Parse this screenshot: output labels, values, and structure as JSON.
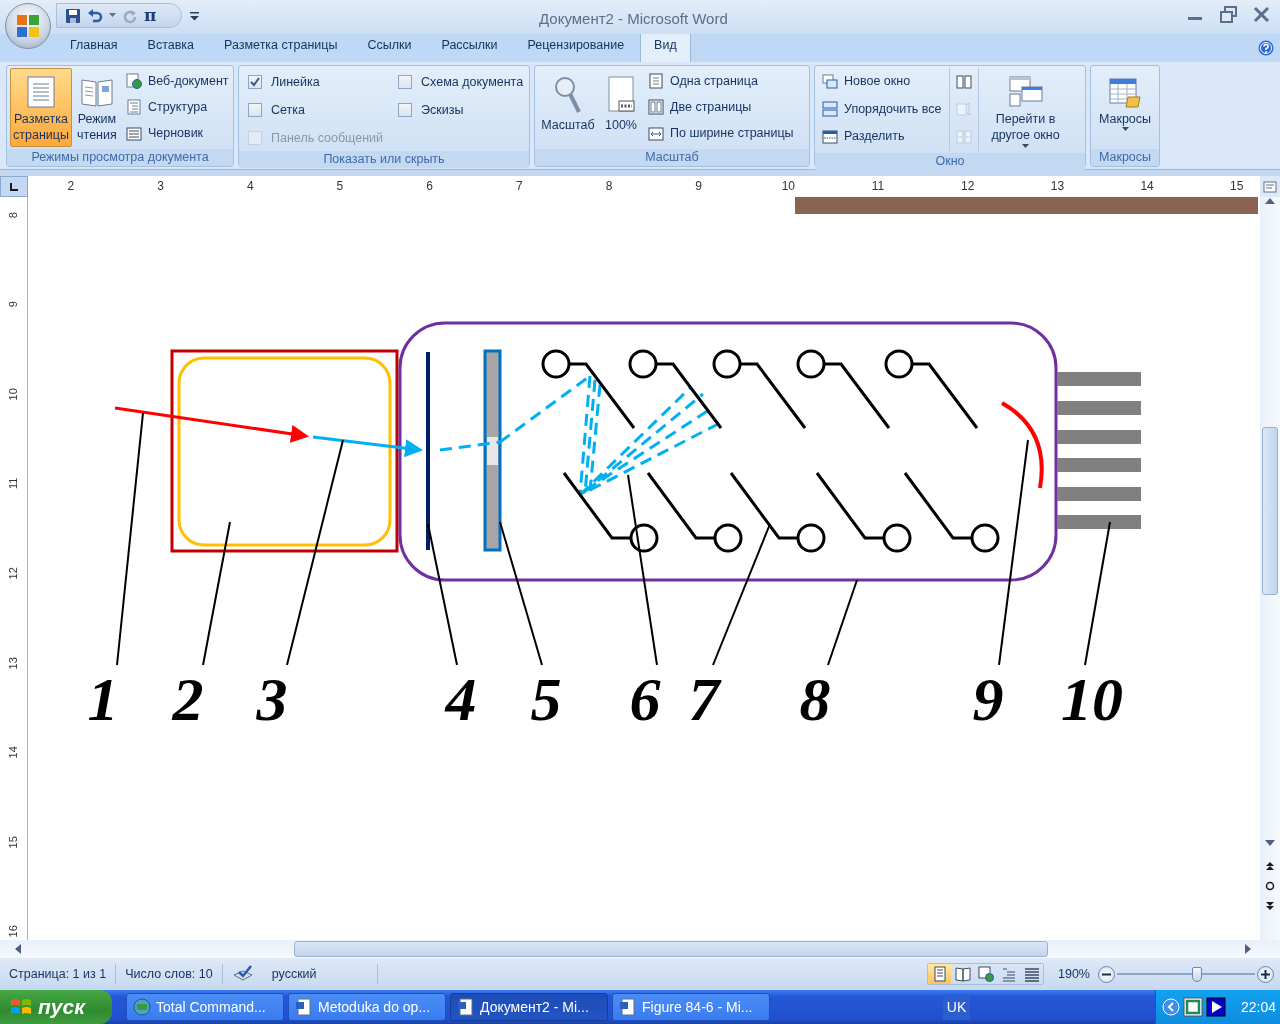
{
  "window": {
    "title": "Документ2 - Microsoft Word"
  },
  "quick_access": {
    "equation_symbol": "π"
  },
  "tabs": [
    {
      "label": "Главная",
      "selected": false
    },
    {
      "label": "Вставка",
      "selected": false
    },
    {
      "label": "Разметка страницы",
      "selected": false
    },
    {
      "label": "Ссылки",
      "selected": false
    },
    {
      "label": "Рассылки",
      "selected": false
    },
    {
      "label": "Рецензирование",
      "selected": false
    },
    {
      "label": "Вид",
      "selected": true
    }
  ],
  "ribbon": {
    "groups": [
      {
        "title": "Режимы просмотра документа",
        "columns": [
          {
            "kind": "large",
            "label": "Разметка страницы",
            "selected": true
          },
          {
            "kind": "large",
            "label": "Режим чтения",
            "selected": false
          },
          {
            "kind": "stack",
            "items": [
              {
                "label": "Веб-документ"
              },
              {
                "label": "Структура"
              },
              {
                "label": "Черновик"
              }
            ]
          }
        ]
      },
      {
        "title": "Показать или скрыть",
        "columns": [
          {
            "kind": "checks",
            "items": [
              {
                "label": "Линейка",
                "checked": true,
                "disabled": false
              },
              {
                "label": "Сетка",
                "checked": false,
                "disabled": false
              },
              {
                "label": "Панель сообщений",
                "checked": false,
                "disabled": true
              }
            ]
          },
          {
            "kind": "checks",
            "items": [
              {
                "label": "Схема документа",
                "checked": false,
                "disabled": false
              },
              {
                "label": "Эскизы",
                "checked": false,
                "disabled": false
              }
            ]
          }
        ]
      },
      {
        "title": "Масштаб",
        "columns": [
          {
            "kind": "large",
            "label": "Масштаб"
          },
          {
            "kind": "large",
            "label": "100%"
          },
          {
            "kind": "stack",
            "items": [
              {
                "label": "Одна страница"
              },
              {
                "label": "Две страницы"
              },
              {
                "label": "По ширине страницы"
              }
            ]
          }
        ]
      },
      {
        "title": "Окно",
        "columns": [
          {
            "kind": "stack",
            "items": [
              {
                "label": "Новое окно"
              },
              {
                "label": "Упорядочить все"
              },
              {
                "label": "Разделить"
              }
            ]
          },
          {
            "kind": "icons",
            "items": [
              {
                "disabled": false
              },
              {
                "disabled": true
              },
              {
                "disabled": true
              }
            ]
          },
          {
            "kind": "large",
            "label": "Перейти в другое окно",
            "dropdown": true
          }
        ]
      },
      {
        "title": "Макросы",
        "columns": [
          {
            "kind": "large",
            "label": "Макросы",
            "dropdown": true
          }
        ]
      }
    ]
  },
  "ruler": {
    "horizontal": [
      "2",
      "3",
      "4",
      "5",
      "6",
      "7",
      "8",
      "9",
      "10",
      "11",
      "12",
      "13",
      "14",
      "15"
    ],
    "vertical": [
      "8",
      "9",
      "10",
      "11",
      "12",
      "13",
      "14",
      "15",
      "16"
    ]
  },
  "diagram": {
    "labels": [
      "1",
      "2",
      "3",
      "4",
      "5",
      "6",
      "7",
      "8",
      "9",
      "10"
    ]
  },
  "status_bar": {
    "page": "Страница: 1 из 1",
    "words": "Число слов: 10",
    "language": "русский",
    "views": [
      {
        "selected": true
      },
      {
        "selected": false
      },
      {
        "selected": false
      },
      {
        "selected": false
      },
      {
        "selected": false
      }
    ],
    "zoom": "190%",
    "zoom_slider": {
      "level": 0.58
    }
  },
  "taskbar": {
    "start": "пуск",
    "items": [
      {
        "label": "Total Command...",
        "selected": false
      },
      {
        "label": "Metoduka do op...",
        "selected": false
      },
      {
        "label": "Документ2 - Mi...",
        "selected": true
      },
      {
        "label": "Figure 84-6 - Mi...",
        "selected": false
      }
    ],
    "language": "UK",
    "clock": "22:04"
  }
}
